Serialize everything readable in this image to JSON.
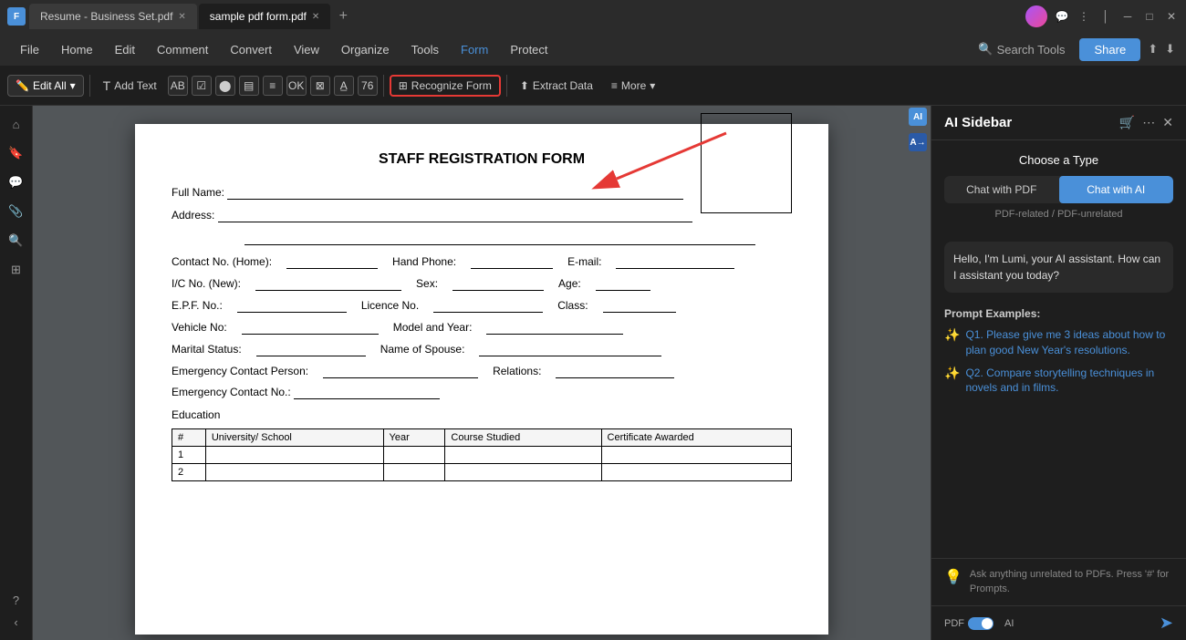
{
  "titlebar": {
    "app_icon": "F",
    "tabs": [
      {
        "label": "Resume - Business Set.pdf",
        "active": false
      },
      {
        "label": "sample pdf form.pdf",
        "active": true
      }
    ],
    "add_tab_label": "+",
    "window_controls": [
      "minimize",
      "maximize",
      "close"
    ]
  },
  "menubar": {
    "items": [
      "File",
      "Home",
      "Edit",
      "Comment",
      "Convert",
      "View",
      "Organize",
      "Tools",
      "Form",
      "Protect"
    ],
    "search_tools": "Search Tools",
    "share": "Share"
  },
  "toolbar": {
    "edit_all": "Edit All",
    "recognize_form": "Recognize Form",
    "extract_data": "Extract Data",
    "more": "More"
  },
  "ai_sidebar": {
    "title": "AI Sidebar",
    "choose_type": "Choose a Type",
    "chat_with_pdf": "Chat with PDF",
    "chat_with_ai": "Chat with AI",
    "pdf_note": "PDF-related / PDF-unrelated",
    "greeting": "Hello, I'm Lumi, your AI assistant. How can I assistant you today?",
    "prompt_examples_label": "Prompt Examples:",
    "prompts": [
      "Q1. Please give me 3 ideas about how to plan good New Year's resolutions.",
      "Q2. Compare storytelling techniques in novels and in films."
    ],
    "hint_text": "Ask anything unrelated to PDFs. Press '#' for Prompts.",
    "pdf_toggle_label": "PDF",
    "ai_toggle_label": "AI"
  },
  "pdf": {
    "title": "STAFF REGISTRATION FORM",
    "fields": {
      "full_name": "Full Name:",
      "address": "Address:",
      "contact_home": "Contact No. (Home):",
      "hand_phone": "Hand Phone:",
      "email": "E-mail:",
      "ic_no": "I/C No. (New):",
      "sex": "Sex:",
      "age": "Age:",
      "epf_no": "E.P.F. No.:",
      "licence_no": "Licence No.",
      "class": "Class:",
      "vehicle_no": "Vehicle No:",
      "model_year": "Model and Year:",
      "marital_status": "Marital Status:",
      "name_of_spouse": "Name of Spouse:",
      "emergency_contact_person": "Emergency Contact Person:",
      "relations": "Relations:",
      "emergency_contact_no": "Emergency Contact No.:",
      "education": "Education"
    },
    "education_table": {
      "headers": [
        "#",
        "University/ School",
        "Year",
        "Course Studied",
        "Certificate Awarded"
      ],
      "rows": [
        [
          "1",
          "",
          "",
          "",
          ""
        ],
        [
          "2",
          "",
          "",
          "",
          ""
        ]
      ]
    }
  }
}
